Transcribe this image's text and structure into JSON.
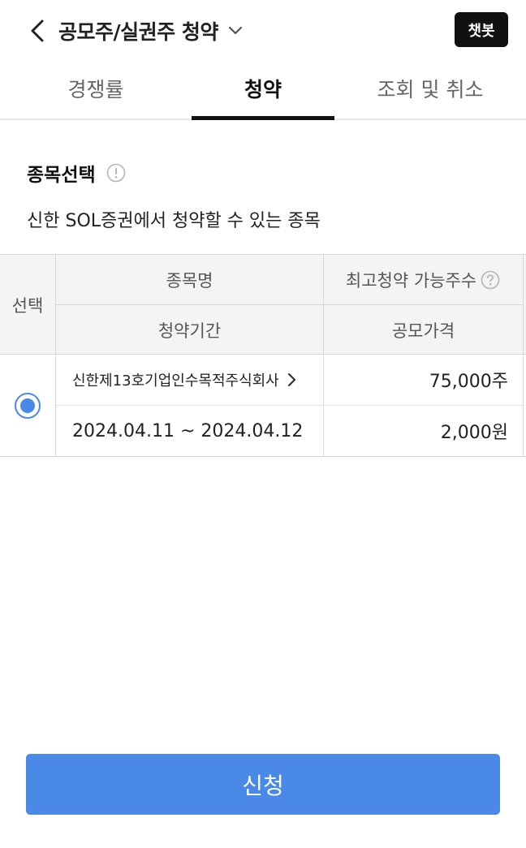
{
  "header": {
    "title": "공모주/실권주 청약",
    "chatbot_label": "챗봇"
  },
  "tabs": [
    {
      "label": "경쟁률",
      "active": false
    },
    {
      "label": "청약",
      "active": true
    },
    {
      "label": "조회 및 취소",
      "active": false
    }
  ],
  "section": {
    "title": "종목선택",
    "description": "신한 SOL증권에서 청약할 수 있는 종목"
  },
  "table": {
    "headers": {
      "select": "선택",
      "name": "종목명",
      "max_shares": "최고청약 가능주수",
      "period": "청약기간",
      "price": "공모가격"
    },
    "rows": [
      {
        "selected": true,
        "name": "신한제13호기업인수목적주식회사",
        "max_shares": "75,000주",
        "period": "2024.04.11 ~ 2024.04.12",
        "price": "2,000원"
      }
    ]
  },
  "submit_label": "신청",
  "colors": {
    "accent": "#4a8ae6",
    "chatbot_bg": "#111111"
  }
}
